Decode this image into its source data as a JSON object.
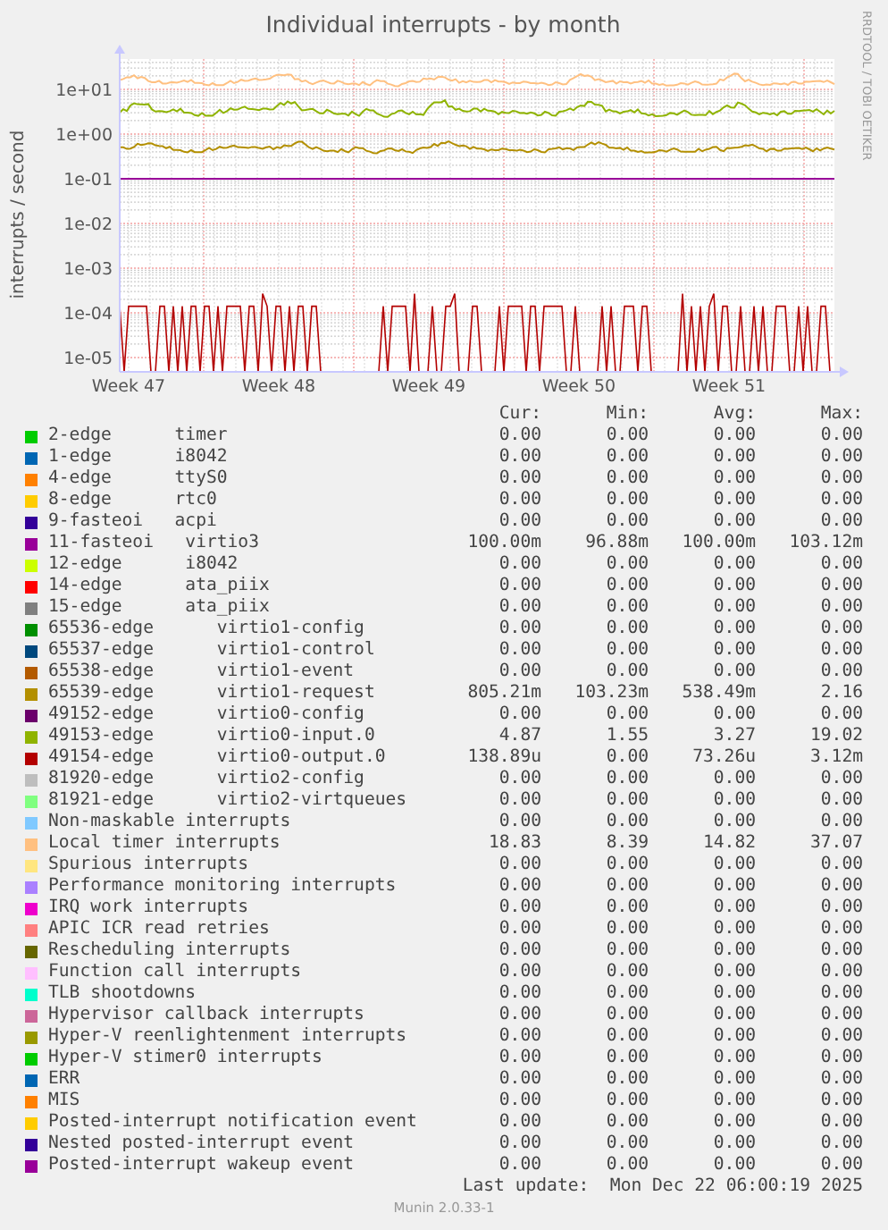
{
  "graph": {
    "title": "Individual interrupts - by month",
    "y_axis_label": "interrupts / second",
    "credit": "RRDTOOL / TOBI OETIKER",
    "y_ticks": [
      "1e+01",
      "1e+00",
      "1e-01",
      "1e-02",
      "1e-03",
      "1e-04",
      "1e-05"
    ],
    "x_ticks": [
      "Week 47",
      "Week 48",
      "Week 49",
      "Week 50",
      "Week 51"
    ]
  },
  "legend": {
    "columns": [
      "Cur:",
      "Min:",
      "Avg:",
      "Max:"
    ],
    "rows": [
      {
        "label": "2-edge      timer",
        "color": "#00cc00",
        "cur": "0.00",
        "min": "0.00",
        "avg": "0.00",
        "max": "0.00"
      },
      {
        "label": "1-edge      i8042",
        "color": "#0066b3",
        "cur": "0.00",
        "min": "0.00",
        "avg": "0.00",
        "max": "0.00"
      },
      {
        "label": "4-edge      ttyS0",
        "color": "#ff8000",
        "cur": "0.00",
        "min": "0.00",
        "avg": "0.00",
        "max": "0.00"
      },
      {
        "label": "8-edge      rtc0",
        "color": "#ffcc00",
        "cur": "0.00",
        "min": "0.00",
        "avg": "0.00",
        "max": "0.00"
      },
      {
        "label": "9-fasteoi   acpi",
        "color": "#330099",
        "cur": "0.00",
        "min": "0.00",
        "avg": "0.00",
        "max": "0.00"
      },
      {
        "label": "11-fasteoi   virtio3",
        "color": "#990099",
        "cur": "100.00m",
        "min": "96.88m",
        "avg": "100.00m",
        "max": "103.12m"
      },
      {
        "label": "12-edge      i8042",
        "color": "#ccff00",
        "cur": "0.00",
        "min": "0.00",
        "avg": "0.00",
        "max": "0.00"
      },
      {
        "label": "14-edge      ata_piix",
        "color": "#ff0000",
        "cur": "0.00",
        "min": "0.00",
        "avg": "0.00",
        "max": "0.00"
      },
      {
        "label": "15-edge      ata_piix",
        "color": "#808080",
        "cur": "0.00",
        "min": "0.00",
        "avg": "0.00",
        "max": "0.00"
      },
      {
        "label": "65536-edge      virtio1-config",
        "color": "#008f00",
        "cur": "0.00",
        "min": "0.00",
        "avg": "0.00",
        "max": "0.00"
      },
      {
        "label": "65537-edge      virtio1-control",
        "color": "#00487d",
        "cur": "0.00",
        "min": "0.00",
        "avg": "0.00",
        "max": "0.00"
      },
      {
        "label": "65538-edge      virtio1-event",
        "color": "#b35a00",
        "cur": "0.00",
        "min": "0.00",
        "avg": "0.00",
        "max": "0.00"
      },
      {
        "label": "65539-edge      virtio1-request",
        "color": "#b38f00",
        "cur": "805.21m",
        "min": "103.23m",
        "avg": "538.49m",
        "max": "2.16"
      },
      {
        "label": "49152-edge      virtio0-config",
        "color": "#6b006b",
        "cur": "0.00",
        "min": "0.00",
        "avg": "0.00",
        "max": "0.00"
      },
      {
        "label": "49153-edge      virtio0-input.0",
        "color": "#8fb300",
        "cur": "4.87",
        "min": "1.55",
        "avg": "3.27",
        "max": "19.02"
      },
      {
        "label": "49154-edge      virtio0-output.0",
        "color": "#b30000",
        "cur": "138.89u",
        "min": "0.00",
        "avg": "73.26u",
        "max": "3.12m"
      },
      {
        "label": "81920-edge      virtio2-config",
        "color": "#bebebe",
        "cur": "0.00",
        "min": "0.00",
        "avg": "0.00",
        "max": "0.00"
      },
      {
        "label": "81921-edge      virtio2-virtqueues",
        "color": "#80ff80",
        "cur": "0.00",
        "min": "0.00",
        "avg": "0.00",
        "max": "0.00"
      },
      {
        "label": "Non-maskable interrupts",
        "color": "#80c9ff",
        "cur": "0.00",
        "min": "0.00",
        "avg": "0.00",
        "max": "0.00"
      },
      {
        "label": "Local timer interrupts",
        "color": "#ffc080",
        "cur": "18.83",
        "min": "8.39",
        "avg": "14.82",
        "max": "37.07"
      },
      {
        "label": "Spurious interrupts",
        "color": "#ffe680",
        "cur": "0.00",
        "min": "0.00",
        "avg": "0.00",
        "max": "0.00"
      },
      {
        "label": "Performance monitoring interrupts",
        "color": "#aa80ff",
        "cur": "0.00",
        "min": "0.00",
        "avg": "0.00",
        "max": "0.00"
      },
      {
        "label": "IRQ work interrupts",
        "color": "#ee00cc",
        "cur": "0.00",
        "min": "0.00",
        "avg": "0.00",
        "max": "0.00"
      },
      {
        "label": "APIC ICR read retries",
        "color": "#ff8080",
        "cur": "0.00",
        "min": "0.00",
        "avg": "0.00",
        "max": "0.00"
      },
      {
        "label": "Rescheduling interrupts",
        "color": "#666600",
        "cur": "0.00",
        "min": "0.00",
        "avg": "0.00",
        "max": "0.00"
      },
      {
        "label": "Function call interrupts",
        "color": "#ffbfff",
        "cur": "0.00",
        "min": "0.00",
        "avg": "0.00",
        "max": "0.00"
      },
      {
        "label": "TLB shootdowns",
        "color": "#00ffcc",
        "cur": "0.00",
        "min": "0.00",
        "avg": "0.00",
        "max": "0.00"
      },
      {
        "label": "Hypervisor callback interrupts",
        "color": "#cc6699",
        "cur": "0.00",
        "min": "0.00",
        "avg": "0.00",
        "max": "0.00"
      },
      {
        "label": "Hyper-V reenlightenment interrupts",
        "color": "#999900",
        "cur": "0.00",
        "min": "0.00",
        "avg": "0.00",
        "max": "0.00"
      },
      {
        "label": "Hyper-V stimer0 interrupts",
        "color": "#00cc00",
        "cur": "0.00",
        "min": "0.00",
        "avg": "0.00",
        "max": "0.00"
      },
      {
        "label": "ERR",
        "color": "#0066b3",
        "cur": "0.00",
        "min": "0.00",
        "avg": "0.00",
        "max": "0.00"
      },
      {
        "label": "MIS",
        "color": "#ff8000",
        "cur": "0.00",
        "min": "0.00",
        "avg": "0.00",
        "max": "0.00"
      },
      {
        "label": "Posted-interrupt notification event",
        "color": "#ffcc00",
        "cur": "0.00",
        "min": "0.00",
        "avg": "0.00",
        "max": "0.00"
      },
      {
        "label": "Nested posted-interrupt event",
        "color": "#330099",
        "cur": "0.00",
        "min": "0.00",
        "avg": "0.00",
        "max": "0.00"
      },
      {
        "label": "Posted-interrupt wakeup event",
        "color": "#990099",
        "cur": "0.00",
        "min": "0.00",
        "avg": "0.00",
        "max": "0.00"
      }
    ]
  },
  "last_update": "Last update:  Mon Dec 22 06:00:19 2025",
  "version": "Munin 2.0.33-1"
}
